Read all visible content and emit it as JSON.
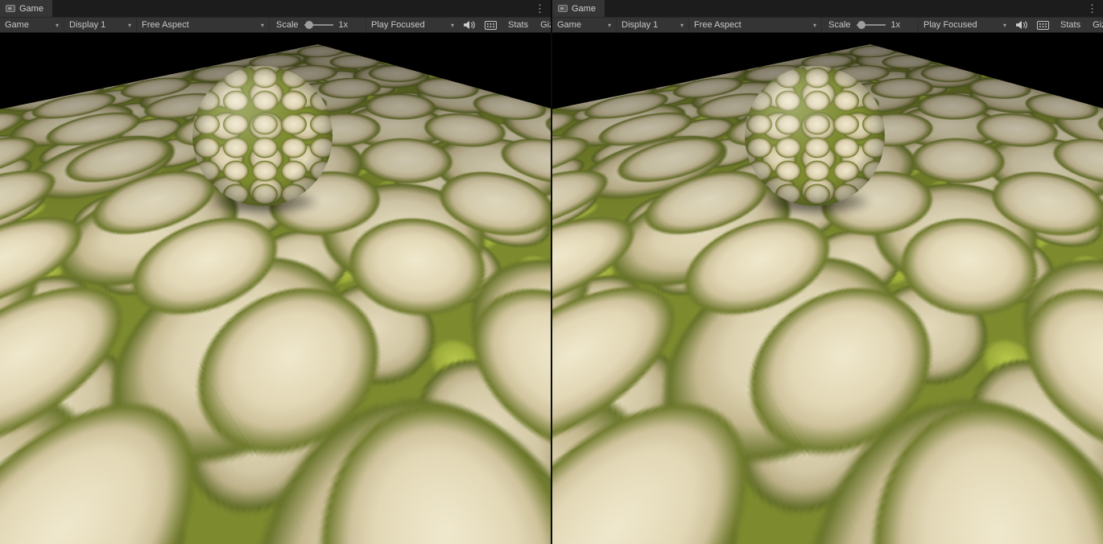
{
  "theme": {
    "chrome_bg": "#1c1c1c",
    "tab_active_bg": "#353535",
    "toolbar_bg": "#343434",
    "toolbar_text": "#c8c8c8",
    "viewport_bg": "#000000",
    "moss_green": "#7d8a2e",
    "stone_tan": "#e8dfc2"
  },
  "icons": {
    "chevron_down": "▾",
    "kebab_menu": "⋮"
  },
  "panels": [
    {
      "tab_label": "Game",
      "toolbar": {
        "game": "Game",
        "display": "Display 1",
        "aspect": "Free Aspect",
        "scale_label": "Scale",
        "scale_value": "1x",
        "play_focused": "Play Focused",
        "stats": "Stats",
        "gizmos": "Gizmos"
      },
      "scene": {
        "objects": [
          "mossy cobblestone ground plane",
          "mossy cobblestone sphere"
        ]
      }
    },
    {
      "tab_label": "Game",
      "toolbar": {
        "game": "Game",
        "display": "Display 1",
        "aspect": "Free Aspect",
        "scale_label": "Scale",
        "scale_value": "1x",
        "play_focused": "Play Focused",
        "stats": "Stats",
        "gizmos": "Gizmos"
      },
      "scene": {
        "objects": [
          "mossy cobblestone ground plane",
          "mossy cobblestone sphere"
        ]
      }
    }
  ]
}
